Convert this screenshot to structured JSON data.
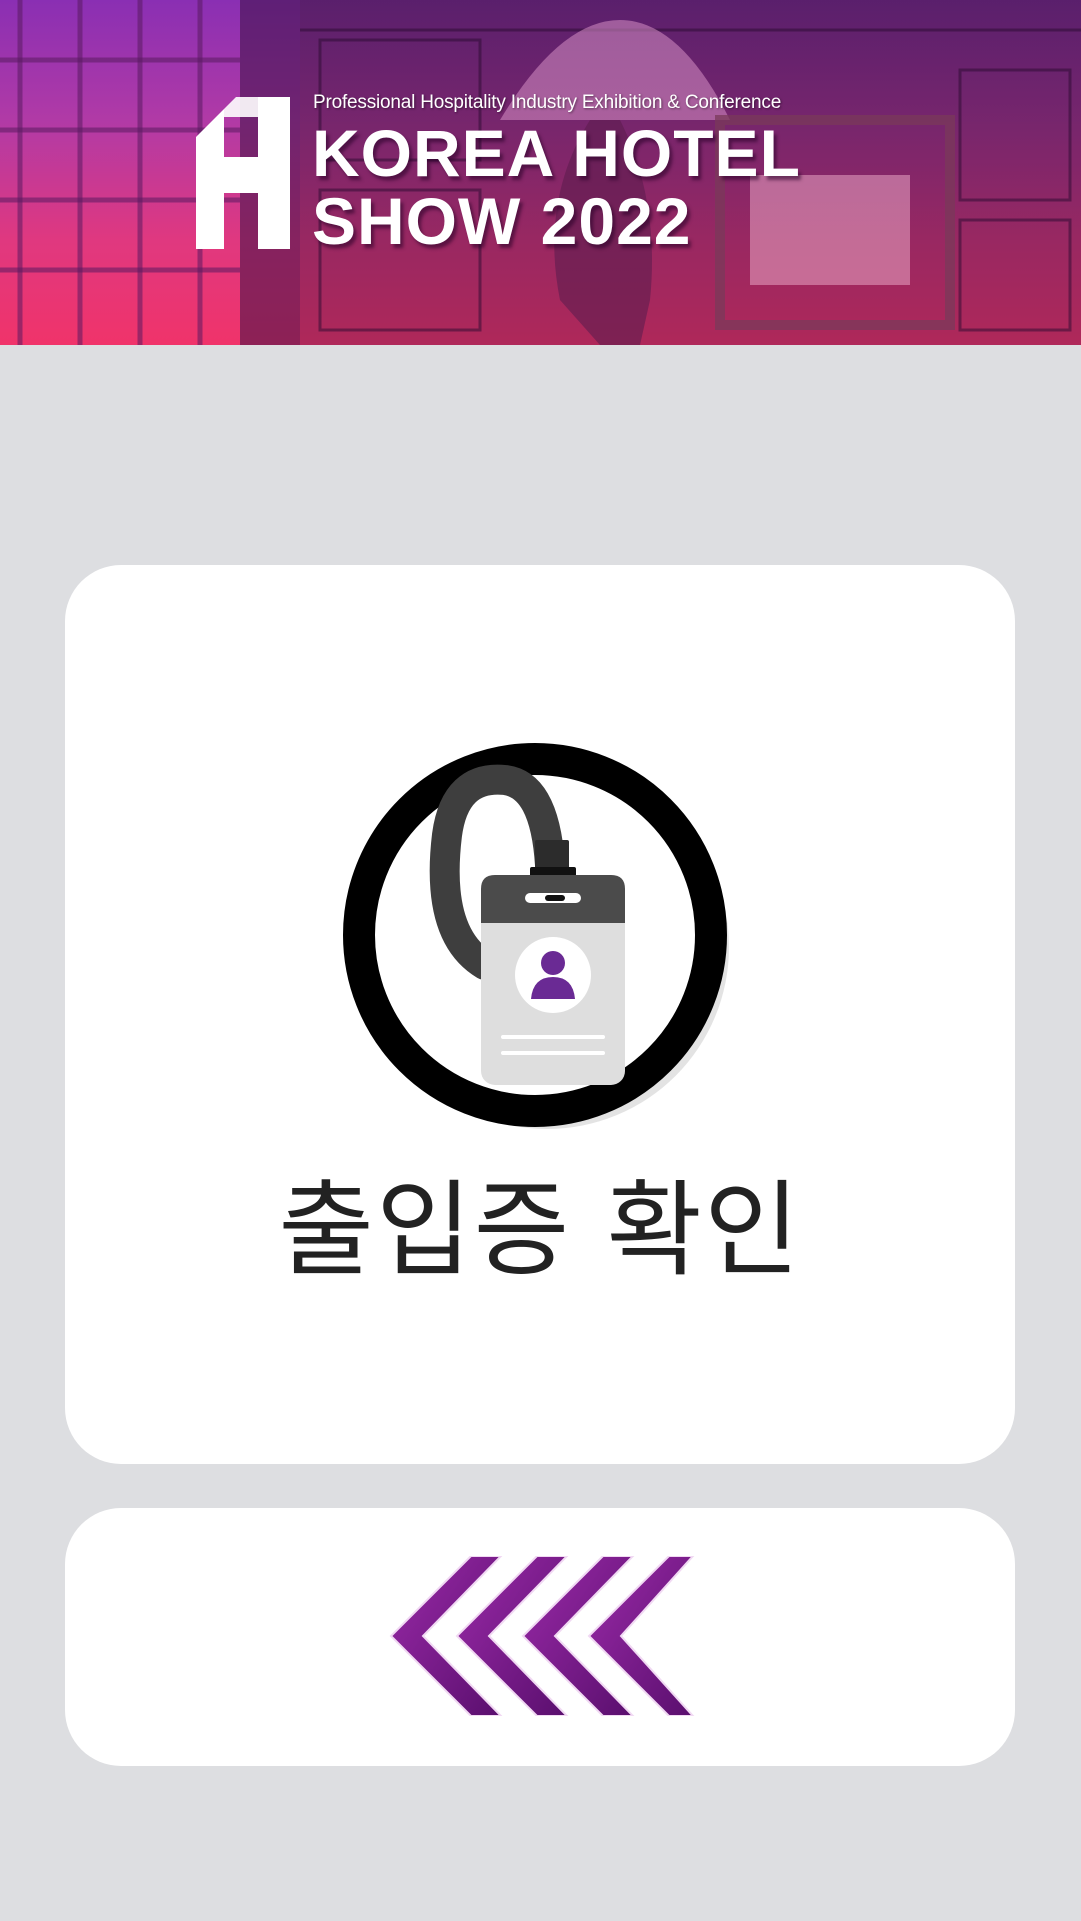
{
  "header": {
    "tagline": "Professional Hospitality Industry Exhibition & Conference",
    "title_line1": "KOREA HOTEL",
    "title_line2": "SHOW 2022",
    "logo_letter": "H"
  },
  "badge_card": {
    "label": "출입증 확인",
    "icon": "id-badge-icon"
  },
  "back_card": {
    "icon": "chevron-left-multiple-icon"
  },
  "colors": {
    "background": "#dddee1",
    "card": "#ffffff",
    "accent_purple": "#7b1a8c",
    "banner_top": "#8a2fb3",
    "banner_bottom": "#f0336a",
    "label_text": "#222222"
  }
}
